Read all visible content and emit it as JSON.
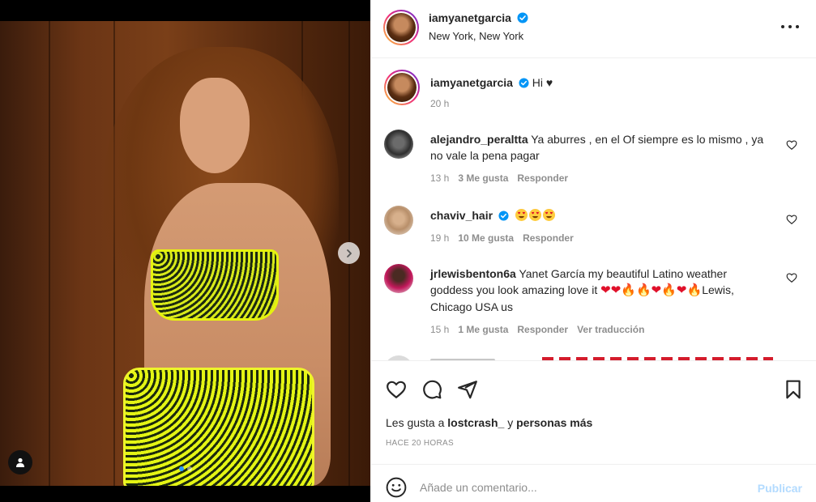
{
  "post": {
    "author": "iamyanetgarcia",
    "location": "New York, New York"
  },
  "caption": {
    "username": "iamyanetgarcia",
    "text": "Hi ♥",
    "time": "20 h"
  },
  "comments": [
    {
      "username": "alejandro_peraltta",
      "text": "Ya aburres , en el Of siempre es lo mismo , ya no vale la pena pagar",
      "time": "13 h",
      "likes": "3 Me gusta",
      "reply": "Responder"
    },
    {
      "username": "chaviv_hair",
      "verified": true,
      "emoji_count": 3,
      "time": "19 h",
      "likes": "10 Me gusta",
      "reply": "Responder"
    },
    {
      "username": "jrlewisbenton6a",
      "text_prefix": "Yanet García my beautiful Latino weather goddess you look amazing love it ",
      "text_suffix": "Lewis, Chicago USA us",
      "time": "15 h",
      "likes": "1 Me gusta",
      "reply": "Responder",
      "translate": "Ver traducción"
    }
  ],
  "likes_line": {
    "prefix": "Les gusta a ",
    "user": "lostcrash_",
    "middle": " y ",
    "rest": "personas más"
  },
  "time_ago": "HACE 20 HORAS",
  "composer": {
    "placeholder": "Añade un comentario...",
    "publish": "Publicar"
  },
  "colors": {
    "verified": "#0095f6",
    "link_disabled": "#b3dbff",
    "meta": "#8e8e8e",
    "carousel_active_dot": "#2d9cff"
  },
  "carousel": {
    "current": 1,
    "total": 2
  }
}
